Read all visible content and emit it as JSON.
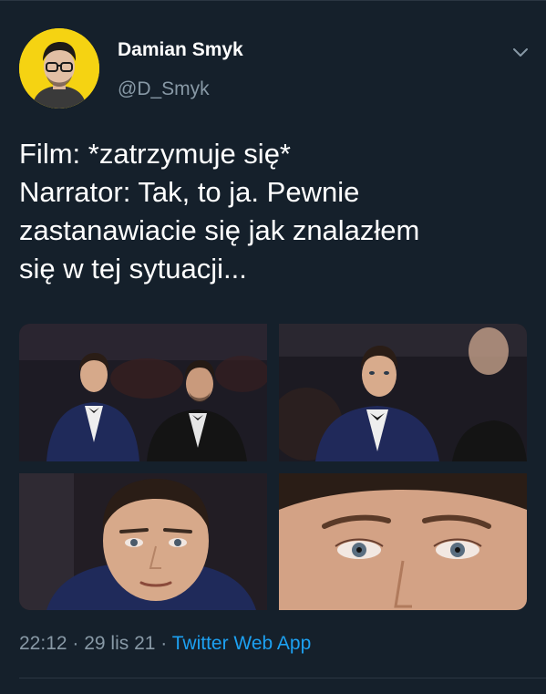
{
  "author": {
    "display_name": "Damian Smyk",
    "handle": "@D_Smyk",
    "avatar_bg": "#f5d312"
  },
  "tweet": {
    "lines": [
      "Film: *zatrzymuje się*",
      "Narrator: Tak, to ja. Pewnie",
      "zastanawiacie się jak znalazłem",
      "się w tej sytuacji..."
    ]
  },
  "media": {
    "photos": [
      {
        "subject": "two-men-in-tuxedos-seated-wide-shot"
      },
      {
        "subject": "man-in-tuxedo-looking-sideways-closer"
      },
      {
        "subject": "face-close-up"
      },
      {
        "subject": "eyes-extreme-close-up"
      }
    ]
  },
  "meta": {
    "time": "22:12",
    "separator": " · ",
    "date": "29 lis 21",
    "source": "Twitter Web App"
  },
  "colors": {
    "background": "#15202b",
    "secondary_text": "#8899a6",
    "link": "#1da1f2"
  },
  "icons": {
    "more": "chevron-down-icon"
  }
}
